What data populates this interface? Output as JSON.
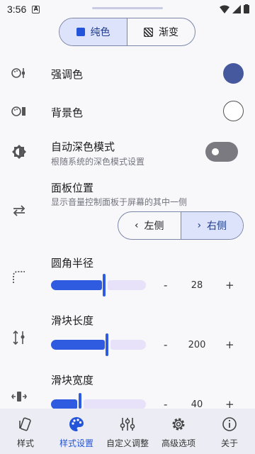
{
  "status": {
    "time": "3:56",
    "notif": "A"
  },
  "mode_tabs": [
    {
      "label": "纯色"
    },
    {
      "label": "渐变"
    }
  ],
  "settings": {
    "accent": {
      "label": "强调色",
      "color": "#46599f"
    },
    "background": {
      "label": "背景色",
      "color": "#ffffff"
    },
    "dark_mode": {
      "label": "自动深色模式",
      "sub": "根随系统的深色模式设置",
      "on": false
    },
    "panel_position": {
      "label": "面板位置",
      "sub": "显示音量控制面板于屏幕的其中一侧",
      "left": "左侧",
      "right": "右侧",
      "selected": "right"
    },
    "corner_radius": {
      "label": "圆角半径",
      "value": "28",
      "minus": "-",
      "plus": "+",
      "fill_fraction": 0.55
    },
    "slider_length": {
      "label": "滑块长度",
      "value": "200",
      "minus": "-",
      "plus": "+",
      "fill_fraction": 0.58
    },
    "slider_width": {
      "label": "滑块宽度",
      "value": "40",
      "minus": "-",
      "plus": "+",
      "fill_fraction": 0.29
    }
  },
  "nav": [
    {
      "label": "样式",
      "icon": "style-icon"
    },
    {
      "label": "样式设置",
      "icon": "palette-icon"
    },
    {
      "label": "自定义调整",
      "icon": "tune-icon"
    },
    {
      "label": "高级选项",
      "icon": "gear-icon"
    },
    {
      "label": "关于",
      "icon": "info-icon"
    }
  ],
  "colors": {
    "accent_blue": "#2f5be0",
    "active_tab_bg": "#dde3fb"
  }
}
